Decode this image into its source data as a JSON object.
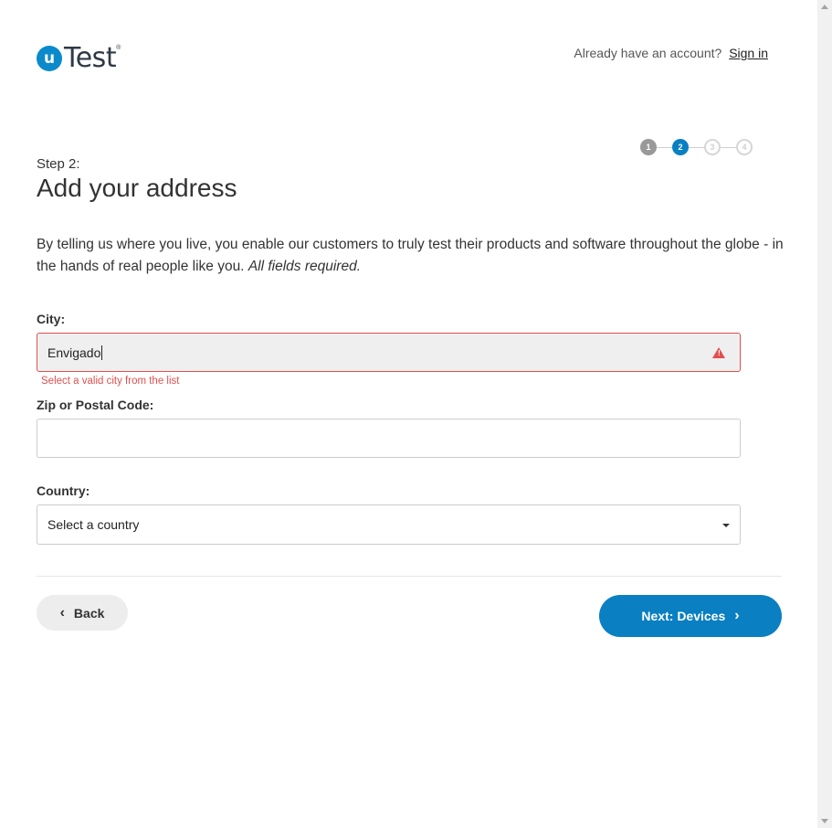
{
  "header": {
    "logo_letter": "u",
    "logo_text": "Test",
    "logo_reg": "®",
    "account_prompt": "Already have an account?",
    "sign_in_label": "Sign in"
  },
  "stepper": {
    "steps": [
      "1",
      "2",
      "3",
      "4"
    ],
    "current": 2
  },
  "form": {
    "step_label": "Step 2:",
    "title": "Add your address",
    "intro_text": "By telling us where you live, you enable our customers to truly test their products and software throughout the globe - in the hands of real people like you.",
    "intro_note": "All fields required.",
    "city": {
      "label": "City:",
      "value": "Envigado",
      "error": "Select a valid city from the list"
    },
    "zip": {
      "label": "Zip or Postal Code:",
      "value": ""
    },
    "country": {
      "label": "Country:",
      "selected": "Select a country"
    }
  },
  "footer": {
    "back_label": "Back",
    "next_label": "Next: Devices"
  },
  "colors": {
    "brand_blue": "#0a7fc2",
    "error_red": "#e0504f"
  }
}
